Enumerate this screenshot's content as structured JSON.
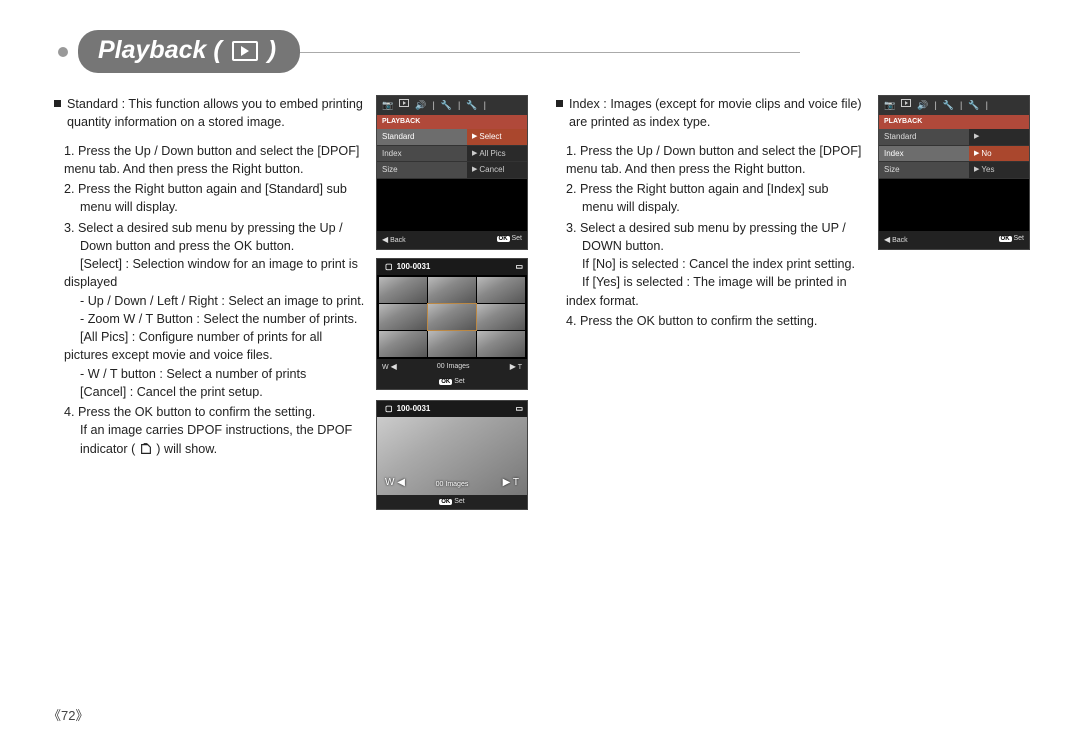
{
  "header": {
    "title_prefix": "Playback ( ",
    "title_suffix": " )"
  },
  "left": {
    "intro_label": "Standard :",
    "intro_text": "This function allows you to embed printing quantity information on a stored image.",
    "steps": {
      "s1": "Press the Up / Down button and select the [DPOF] menu tab. And then press the Right button.",
      "s2a": "Press the Right button again and [Standard] sub",
      "s2b": "menu will display.",
      "s3a": "Select a desired sub menu by pressing the Up /",
      "s3b": "Down button and press the OK button.",
      "s3c": "[Select] : Selection window for an image to print is displayed",
      "s3d": "- Up / Down / Left / Right : Select an image to print.",
      "s3e": "- Zoom W / T Button : Select the number of prints.",
      "s3f": "[All Pics] : Configure number of prints for all pictures except movie and voice files.",
      "s3g": "- W / T button : Select a number of prints",
      "s3h": "[Cancel] : Cancel the print setup.",
      "s4a": "Press the OK button to confirm the setting.",
      "s4b": "If an image carries DPOF instructions, the DPOF",
      "s4c_prefix": "indicator ( ",
      "s4c_suffix": " ) will show."
    }
  },
  "right": {
    "intro_label": "Index :",
    "intro_text": "Images (except for movie clips and voice file) are printed as index type.",
    "steps": {
      "s1": "Press the Up / Down button and select the [DPOF] menu tab. And then press the Right button.",
      "s2a": "Press the Right button again and [Index] sub",
      "s2b": "menu will dispaly.",
      "s3a": "Select a desired sub menu by pressing the UP /",
      "s3b": "DOWN button.",
      "s3c": "If [No] is selected   : Cancel the index print setting.",
      "s3d": "If [Yes] is selected  : The image will be printed in index format.",
      "s4": "Press the OK button to confirm the setting."
    }
  },
  "lcd1": {
    "header": "PLAYBACK",
    "rows": [
      {
        "left": "Standard",
        "right": "Select",
        "hl": true
      },
      {
        "left": "Index",
        "right": "All Pics"
      },
      {
        "left": "Size",
        "right": "Cancel"
      }
    ],
    "back": "Back",
    "ok": "OK",
    "set": "Set"
  },
  "lcd_photo1": {
    "file": "100-0031",
    "w": "W",
    "t": "T",
    "images_label": "00 Images",
    "ok": "OK",
    "set": "Set"
  },
  "lcd_photo2": {
    "file": "100-0031",
    "w": "W",
    "t": "T",
    "images_label": "00 Images",
    "ok": "OK",
    "set": "Set"
  },
  "lcd2": {
    "header": "PLAYBACK",
    "rows": [
      {
        "left": "Standard",
        "right": ""
      },
      {
        "left": "Index",
        "right": "No",
        "hl": true
      },
      {
        "left": "Size",
        "right": "Yes"
      }
    ],
    "back": "Back",
    "ok": "OK",
    "set": "Set"
  },
  "page_number": "《72》"
}
